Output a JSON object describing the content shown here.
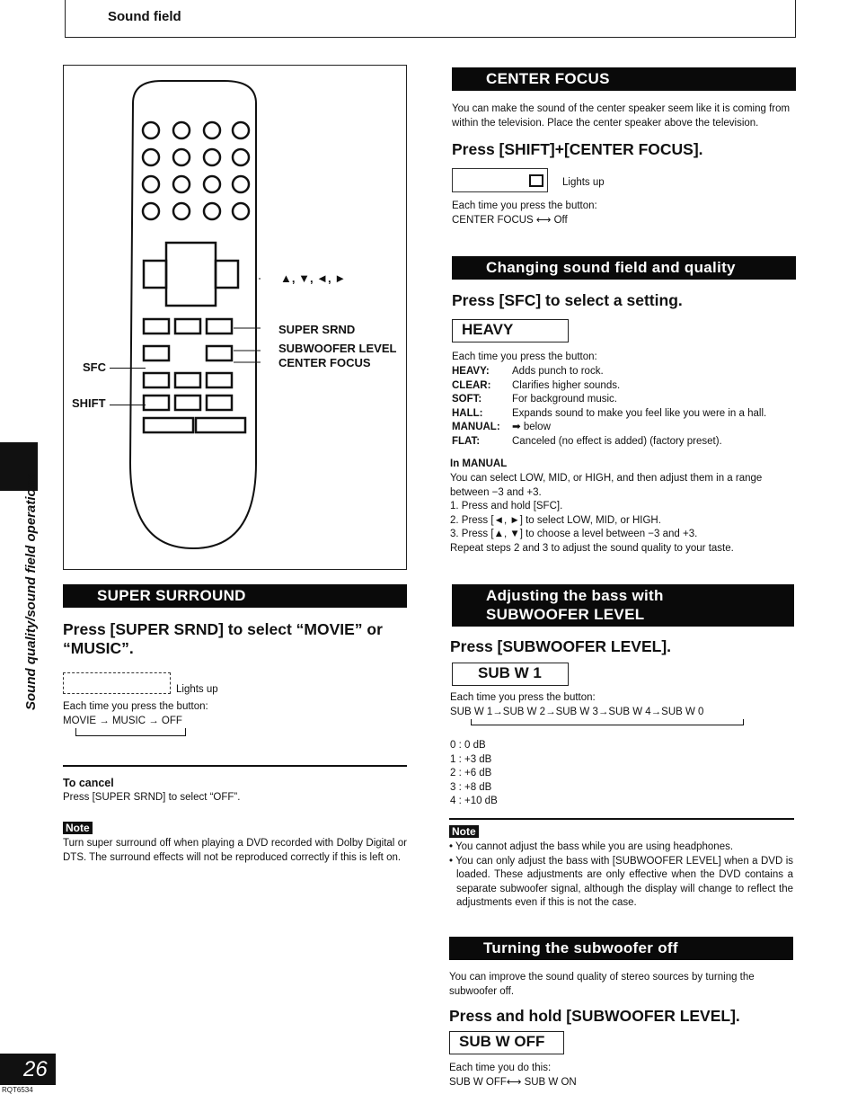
{
  "header": {
    "title": "Sound field"
  },
  "side_tab": {
    "label": "Sound quality/sound field operations"
  },
  "page": {
    "number": "26",
    "code": "RQT6534"
  },
  "remote": {
    "labels": {
      "arrows": "▲, ▼, ◄, ►",
      "super_srnd": "SUPER SRND",
      "subwoofer_level": "SUBWOOFER LEVEL",
      "center_focus": "CENTER FOCUS",
      "sfc": "SFC",
      "shift": "SHIFT"
    }
  },
  "super_surround": {
    "bar": "SUPER SURROUND",
    "heading": "Press [SUPER SRND] to select “MOVIE” or “MUSIC”.",
    "lights_up": "Lights up",
    "each_time": "Each time you press the button:",
    "cycle": "MOVIE → MUSIC → OFF",
    "cancel_title": "To cancel",
    "cancel_text": "Press [SUPER SRND] to select “OFF”.",
    "note_label": "Note",
    "note_text": "Turn super surround off when playing a DVD recorded with Dolby Digital or DTS. The surround effects will not be reproduced correctly if this is left on."
  },
  "center_focus": {
    "bar": "CENTER FOCUS",
    "intro": "You can make the sound of the center speaker seem like it is coming from within the television. Place the center speaker above the television.",
    "heading": "Press [SHIFT]+[CENTER FOCUS].",
    "lights_up": "Lights up",
    "each_time": "Each time you press the button:",
    "cycle": "CENTER FOCUS ⟷ Off"
  },
  "sfc": {
    "bar": "Changing sound field and quality",
    "heading": "Press [SFC] to select a setting.",
    "display": "HEAVY",
    "each_time": "Each time you press the button:",
    "modes": [
      {
        "name": "HEAVY:",
        "desc": "Adds punch to rock."
      },
      {
        "name": "CLEAR:",
        "desc": "Clarifies higher sounds."
      },
      {
        "name": "SOFT:",
        "desc": "For background music."
      },
      {
        "name": "HALL:",
        "desc": "Expands sound to make you feel like you were in a hall."
      },
      {
        "name": "MANUAL:",
        "desc": "➡ below"
      },
      {
        "name": "FLAT:",
        "desc": "Canceled (no effect is added) (factory preset)."
      }
    ],
    "manual_title": "In MANUAL",
    "manual_lines": [
      "You can select LOW, MID, or HIGH, and then adjust them in a range between −3 and +3.",
      "1. Press and hold [SFC].",
      "2. Press [◄, ►] to select LOW, MID, or HIGH.",
      "3. Press [▲, ▼] to choose a level between −3 and +3.",
      "Repeat steps 2 and 3 to adjust the sound quality to your taste."
    ]
  },
  "subwoofer": {
    "bar_line1": "Adjusting the bass with",
    "bar_line2": "SUBWOOFER LEVEL",
    "heading": "Press [SUBWOOFER LEVEL].",
    "display": "SUB W 1",
    "each_time": "Each time you press the button:",
    "cycle": "SUB W 1→SUB W 2→SUB W 3→SUB W 4→SUB W 0",
    "levels": [
      "0 : 0 dB",
      "1 : +3 dB",
      "2 : +6 dB",
      "3 : +8 dB",
      "4 : +10 dB"
    ],
    "note_label": "Note",
    "notes": [
      "You cannot adjust the bass while you are using headphones.",
      "You can only adjust the bass with [SUBWOOFER LEVEL] when a DVD is loaded. These adjustments are only effective when the DVD contains a separate subwoofer signal, although the display will change to reflect the adjustments even if this is not the case."
    ]
  },
  "sub_off": {
    "bar": "Turning the subwoofer off",
    "intro": "You can improve the sound quality of stereo sources by turning the subwoofer off.",
    "heading": "Press and hold [SUBWOOFER LEVEL].",
    "display": "SUB W OFF",
    "each_time": "Each time you do this:",
    "cycle": "SUB W OFF⟷ SUB W ON"
  }
}
